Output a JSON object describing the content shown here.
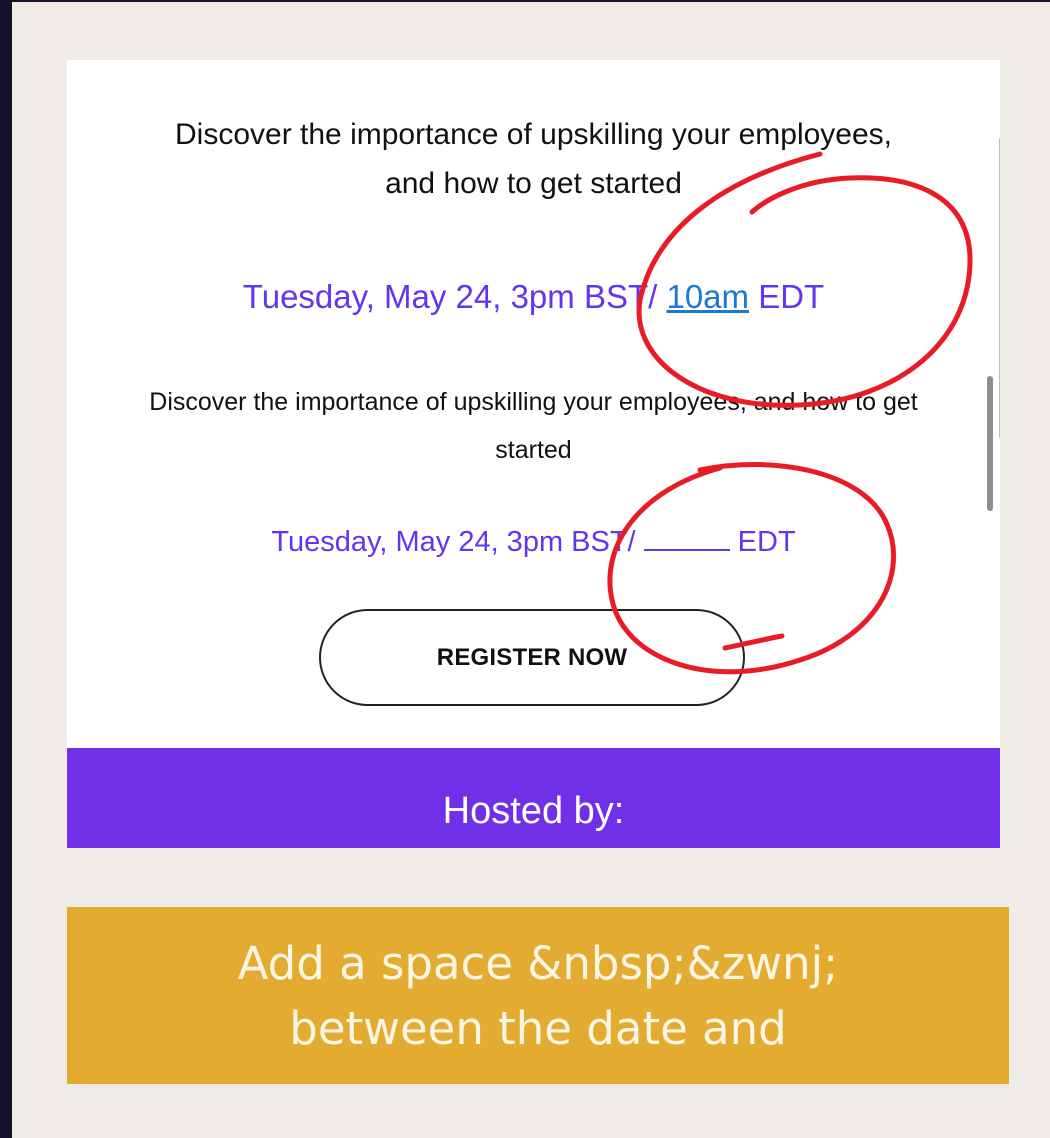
{
  "email": {
    "intro_large": "Discover the importance of upskilling your employees, and how to get started",
    "date_large_prefix": "Tuesday, May 24, 3pm BST/ ",
    "date_large_link": "10am",
    "date_large_suffix": " EDT",
    "intro_small": "Discover the importance of upskilling your employees, and how to get started",
    "date_small_prefix": "Tuesday, May 24, 3pm BST/",
    "date_small_suffix": "EDT",
    "register_label": "REGISTER NOW",
    "host_label": "Hosted by:"
  },
  "colors": {
    "date_text": "#6236f0",
    "link": "#1e77d0",
    "host_band": "#6f30e8",
    "banner": "#e3ab2f",
    "annotation": "#e81c24"
  },
  "caption": {
    "text": "Add a space &nbsp;&zwnj; between the date and"
  }
}
